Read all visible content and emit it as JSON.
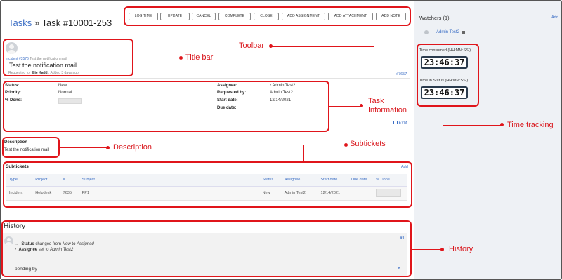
{
  "breadcrumb": {
    "link": "Tasks",
    "sep": "»",
    "title": "Task #10001-253"
  },
  "toolbar": [
    "LOG TIME",
    "UPDATE",
    "CANCEL",
    "COMPLETE",
    "CLOSE",
    "ADD ASSIGNMENT",
    "ADD ATTACHMENT",
    "ADD NOTE"
  ],
  "titlebar": {
    "line1_prefix": "Incident #3576",
    "line1_text": "Test the notification mail",
    "subject": "Test the notification mail",
    "requested_prefix": "Requested for",
    "requested_name": "Elie Kaddi",
    "added": "Added 3 days ago"
  },
  "task_ref": "#7657",
  "info": {
    "status_label": "Status:",
    "status_value": "New",
    "priority_label": "Priority:",
    "priority_value": "Normal",
    "done_label": "% Done:",
    "assignee_label": "Assignee:",
    "assignee_value": "Admin Test2",
    "requested_label": "Requested by:",
    "requested_value": "Admin Test2",
    "start_label": "Start date:",
    "start_value": "12/14/2021",
    "due_label": "Due date:",
    "due_value": ""
  },
  "evm_label": "EVM",
  "description": {
    "heading": "Description",
    "text": "Test the notification mail"
  },
  "subtickets": {
    "heading": "Subtickets",
    "add_label": "Add",
    "columns": [
      "Type",
      "Project",
      "#",
      "Subject",
      "Status",
      "Assignee",
      "Start date",
      "Due date",
      "% Done"
    ],
    "rows": [
      [
        "Incident",
        "Helpdesk",
        "7635",
        "PP1",
        "New",
        "Admin Test2",
        "12/14/2021",
        "",
        ""
      ]
    ]
  },
  "history": {
    "heading": "History",
    "entry_number": "#1",
    "status_label": "Status",
    "status_text_a": " changed from ",
    "status_from": "New",
    "status_text_b": " to ",
    "status_to": "Assigned",
    "assignee_label": "Assignee",
    "assignee_text": " set to ",
    "assignee_value": "Admin Test2",
    "note": "pending by"
  },
  "watchers": {
    "heading": "Watchers (1)",
    "add_label": "Add",
    "user": "Admin Test2"
  },
  "time_tracking": {
    "consumed_label": "Time consumed (HH:MM:SS )",
    "consumed_value": "23:46:37",
    "status_label": "Time in Status (HH:MM:SS )",
    "status_value": "23:46:37"
  },
  "annotations": {
    "toolbar": "Toolbar",
    "title_bar": "Title bar",
    "task_info_1": "Task",
    "task_info_2": "Information",
    "description": "Description",
    "subtickets": "Subtickets",
    "time_tracking": "Time tracking",
    "history": "History"
  },
  "colors": {
    "annotation": "#e0151b",
    "link": "#3b6ec5",
    "sidebar": "#eef1f5",
    "timer_border": "#2a3b4e"
  }
}
